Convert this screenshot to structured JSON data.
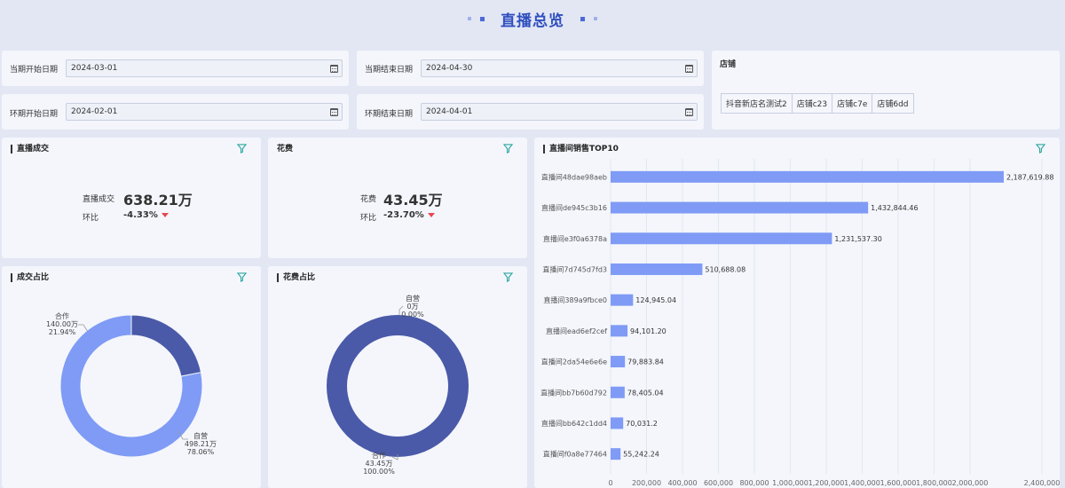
{
  "page_title": "直播总览",
  "filters": {
    "cur_start_label": "当期开始日期",
    "cur_start_value": "2024-03-01",
    "cur_end_label": "当期结束日期",
    "cur_end_value": "2024-04-30",
    "prev_start_label": "环期开始日期",
    "prev_start_value": "2024-02-01",
    "prev_end_label": "环期结束日期",
    "prev_end_value": "2024-04-01",
    "shop_label": "店铺",
    "shops": [
      "抖音新店名测试2",
      "店铺c23",
      "店铺c7e",
      "店铺6dd"
    ]
  },
  "live_deal": {
    "title": "直播成交",
    "label": "直播成交",
    "value": "638.21万",
    "chg_label": "环比",
    "chg_value": "-4.33%"
  },
  "cost": {
    "title": "花费",
    "label": "花费",
    "value": "43.45万",
    "chg_label": "环比",
    "chg_value": "-23.70%"
  },
  "deal_share": {
    "title": "成交占比",
    "labels": [
      {
        "name": "合作",
        "amount": "140.00万",
        "pct": "21.94%"
      },
      {
        "name": "自营",
        "amount": "498.21万",
        "pct": "78.06%"
      }
    ]
  },
  "cost_share": {
    "title": "花费占比",
    "labels": [
      {
        "name": "自营",
        "amount": "0万",
        "pct": "0.00%"
      },
      {
        "name": "合作",
        "amount": "43.45万",
        "pct": "100.00%"
      }
    ]
  },
  "colors": {
    "light": "#7f9bf5",
    "dark": "#4a5aa8",
    "accent": "#2f4fbf",
    "down": "#e8474f",
    "filter_icon": "#2aa6a0"
  },
  "chart_data": [
    {
      "type": "pie",
      "title": "成交占比",
      "categories": [
        "合作",
        "自营"
      ],
      "values": [
        140.0,
        498.21
      ],
      "percentages": [
        21.94,
        78.06
      ],
      "unit": "万"
    },
    {
      "type": "pie",
      "title": "花费占比",
      "categories": [
        "自营",
        "合作"
      ],
      "values": [
        0,
        43.45
      ],
      "percentages": [
        0.0,
        100.0
      ],
      "unit": "万"
    },
    {
      "type": "bar",
      "orientation": "horizontal",
      "title": "直播间销售TOP10",
      "categories": [
        "直播间48dae98aeb",
        "直播间de945c3b16",
        "直播间e3f0a6378a",
        "直播间7d745d7fd3",
        "直播间389a9fbce0",
        "直播间ead6ef2cef",
        "直播间2da54e6e6e",
        "直播间bb7b60d792",
        "直播间bb642c1dd4",
        "直播间f0a8e77464"
      ],
      "values": [
        2187619.88,
        1432844.46,
        1231537.3,
        510688.08,
        124945.04,
        94101.2,
        79883.84,
        78405.04,
        70031.2,
        55242.24
      ],
      "value_labels": [
        "2,187,619.88",
        "1,432,844.46",
        "1,231,537.30",
        "510,688.08",
        "124,945.04",
        "94,101.20",
        "79,883.84",
        "78,405.04",
        "70,031.2",
        "55,242.24"
      ],
      "xlim": [
        0,
        2400000
      ],
      "xticks": [
        0,
        200000,
        400000,
        600000,
        800000,
        1000000,
        1200000,
        1400000,
        1600000,
        1800000,
        2000000,
        2400000
      ],
      "xtick_labels": [
        "0",
        "200,000",
        "400,000",
        "600,000",
        "800,000",
        "1,000,000",
        "1,200,000",
        "1,400,000",
        "1,600,000",
        "1,800,000",
        "2,000,000",
        "2,400,000"
      ],
      "grid": true
    }
  ]
}
